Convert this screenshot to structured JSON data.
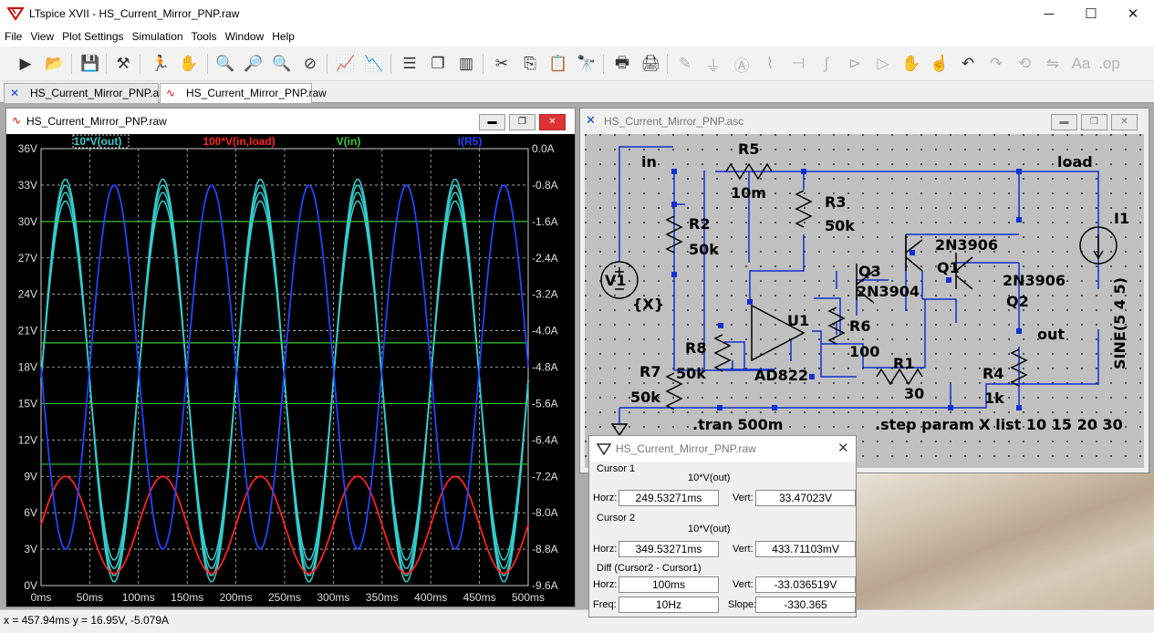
{
  "app": {
    "title": "LTspice XVII - HS_Current_Mirror_PNP.raw",
    "window_buttons": [
      "─",
      "☐",
      "✕"
    ]
  },
  "menu": [
    "File",
    "View",
    "Plot Settings",
    "Simulation",
    "Tools",
    "Window",
    "Help"
  ],
  "toolbar_icons": [
    "run-icon",
    "open-folder-icon",
    "save-icon",
    "hammer-icon",
    "runner-icon",
    "hand-icon",
    "zoom-in-icon",
    "zoom-area-icon",
    "zoom-out-icon",
    "zoom-cancel-icon",
    "autorange-icon",
    "spectrum-icon",
    "tile-horizontal-icon",
    "cascade-icon",
    "tile-vertical-icon",
    "cut-icon",
    "copy-icon",
    "paste-icon",
    "find-icon",
    "print-setup-icon",
    "print-icon",
    "wire-icon",
    "ground-icon",
    "label-icon",
    "resistor-icon",
    "capacitor-icon",
    "inductor-icon",
    "diode-icon",
    "component-icon",
    "move-icon",
    "drag-icon",
    "undo-icon",
    "redo-icon",
    "rotate-icon",
    "mirror-icon",
    "text-icon",
    "spice-directive-icon"
  ],
  "tabs": [
    {
      "label": "HS_Current_Mirror_PNP.asc",
      "icon": "schematic-icon"
    },
    {
      "label": "HS_Current_Mirror_PNP.raw",
      "icon": "waveform-icon"
    }
  ],
  "plot_window": {
    "title": "HS_Current_Mirror_PNP.raw",
    "traces": [
      {
        "label": "10*V(out)",
        "color": "#33cccc"
      },
      {
        "label": "100*V(in,load)",
        "color": "#ff2020"
      },
      {
        "label": "V(in)",
        "color": "#33cc33"
      },
      {
        "label": "I(R5)",
        "color": "#2244ff"
      }
    ]
  },
  "chart_data": {
    "type": "line",
    "x_ticks": [
      "0ms",
      "50ms",
      "100ms",
      "150ms",
      "200ms",
      "250ms",
      "300ms",
      "350ms",
      "400ms",
      "450ms",
      "500ms"
    ],
    "y_left_ticks": [
      "36V",
      "33V",
      "30V",
      "27V",
      "24V",
      "21V",
      "18V",
      "15V",
      "12V",
      "9V",
      "6V",
      "3V",
      "0V"
    ],
    "y_right_ticks": [
      "0.0A",
      "-0.8A",
      "-1.6A",
      "-2.4A",
      "-3.2A",
      "-4.0A",
      "-4.8A",
      "-5.6A",
      "-6.4A",
      "-7.2A",
      "-8.0A",
      "-8.8A",
      "-9.6A"
    ],
    "xlim": [
      0,
      500
    ],
    "ylim_left": [
      0,
      36
    ],
    "ylim_right": [
      -9.6,
      0
    ],
    "grid": true,
    "steps": [
      10,
      15,
      20,
      30
    ],
    "series": [
      {
        "name": "10*V(out)",
        "axis": "left",
        "shape": "sine",
        "freq_hz": 10,
        "offset": 16.9,
        "amplitudes": [
          14.8,
          15.5,
          16.1,
          16.6
        ]
      },
      {
        "name": "100*V(in,load)",
        "axis": "left",
        "shape": "sine",
        "freq_hz": 10,
        "offset": 5.0,
        "amplitude": 4.0
      },
      {
        "name": "V(in)",
        "axis": "left",
        "shape": "levels",
        "levels": [
          10,
          15,
          20,
          30
        ]
      },
      {
        "name": "I(R5)",
        "axis": "right",
        "shape": "sine",
        "freq_hz": 10,
        "offset": -4.8,
        "amplitude": -4.0
      }
    ]
  },
  "schematic_window": {
    "title": "HS_Current_Mirror_PNP.asc",
    "labels": {
      "in": "in",
      "load": "load",
      "out": "out",
      "R5": "R5",
      "R5v": "10m",
      "R3": "R3",
      "R3v": "50k",
      "R2": "R2",
      "R2v": "50k",
      "V1": "V1",
      "V1v": "{X}",
      "U1": "U1",
      "U1v": "AD822",
      "Q3": "Q3",
      "Q3v": "2N3904",
      "Q1": "Q1",
      "Q1v": "2N3906",
      "Q2": "Q2",
      "Q2v": "2N3906",
      "R6": "R6",
      "R6v": "100",
      "R8": "R8",
      "R8v": "50k",
      "R7": "R7",
      "R7v": "50k",
      "R1": "R1",
      "R1v": "30",
      "R4": "R4",
      "R4v": "1k",
      "I1": "I1",
      "I1v": "SINE(5 4 5)",
      "tran": ".tran 500m",
      "step": ".step param X list 10 15 20 30"
    }
  },
  "cursor_window": {
    "title": "HS_Current_Mirror_PNP.raw",
    "cursor1": {
      "label": "Cursor 1",
      "trace": "10*V(out)",
      "horz_label": "Horz:",
      "horz": "249.53271ms",
      "vert_label": "Vert:",
      "vert": "33.47023V"
    },
    "cursor2": {
      "label": "Cursor 2",
      "trace": "10*V(out)",
      "horz_label": "Horz:",
      "horz": "349.53271ms",
      "vert_label": "Vert:",
      "vert": "433.71103mV"
    },
    "diff": {
      "label": "Diff (Cursor2 - Cursor1)",
      "horz_label": "Horz:",
      "horz": "100ms",
      "vert_label": "Vert:",
      "vert": "-33.036519V",
      "freq_label": "Freq:",
      "freq": "10Hz",
      "slope_label": "Slope:",
      "slope": "-330.365"
    }
  },
  "status": "x = 457.94ms    y = 16.95V, -5.079A"
}
